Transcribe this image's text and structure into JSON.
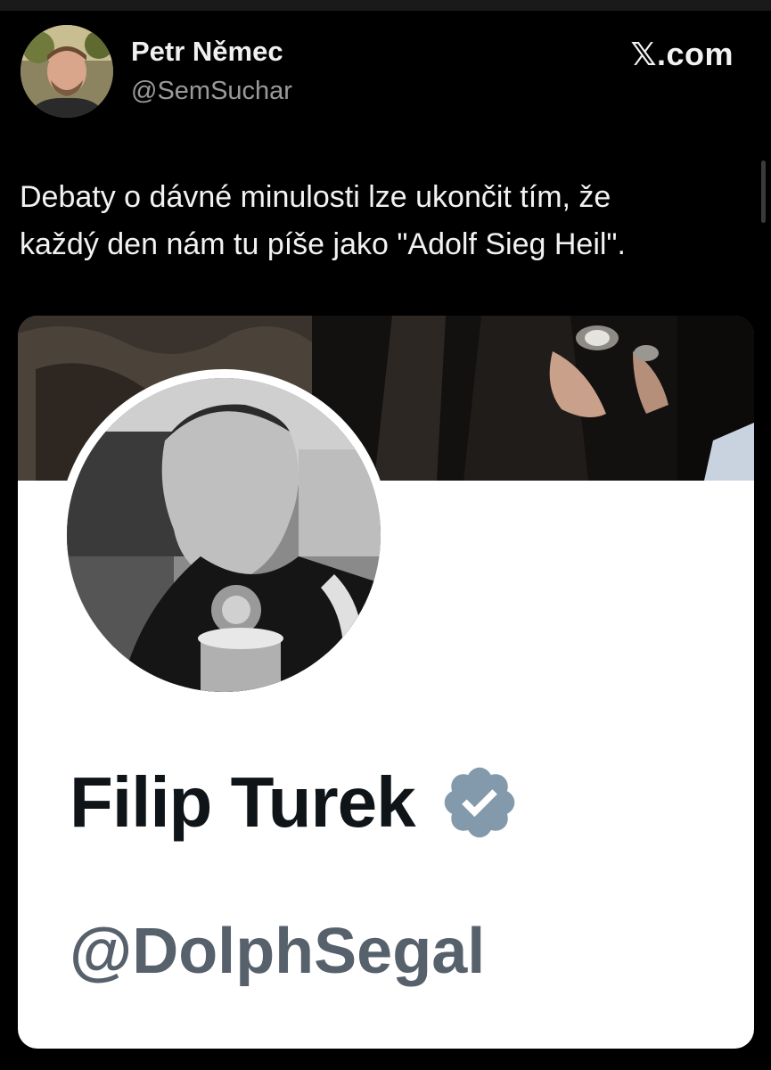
{
  "author": {
    "name": "Petr Němec",
    "handle": "@SemSuchar"
  },
  "source": "𝕏.com",
  "tweet": {
    "line1": "Debaty o dávné minulosti lze ukončit tím, že",
    "line2": "každý den nám tu píše jako \"Adolf Sieg Heil\"."
  },
  "embedded_profile": {
    "display_name": "Filip Turek",
    "handle": "@DolphSegal",
    "verified_icon": "verified-badge-icon",
    "verified_color": "#829aab"
  },
  "colors": {
    "background": "#000000",
    "secondary_text": "#9a9a9a",
    "card_background": "#ffffff",
    "profile_name": "#0f1419",
    "profile_handle": "#56616c"
  }
}
